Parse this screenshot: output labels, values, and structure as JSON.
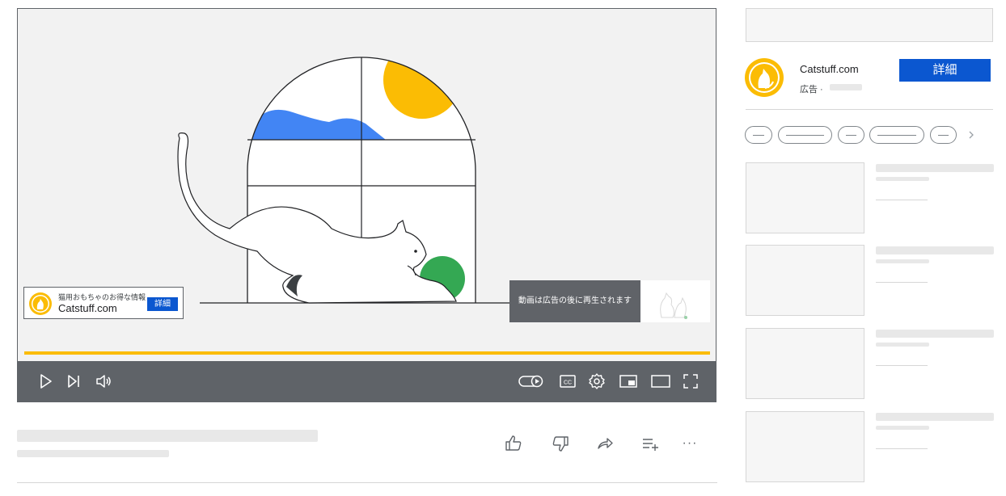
{
  "player": {
    "ad_card": {
      "tagline": "猫用おもちゃのお得な情報",
      "site": "Catstuff.com",
      "button_label": "詳細"
    },
    "after_ad_text": "動画は広告の後に再生されます",
    "progress_fraction": 1.0,
    "progress_color": "#fbbc04",
    "controls": [
      "play-icon",
      "next-icon",
      "volume-icon",
      "autoplay-toggle-icon",
      "captions-icon",
      "settings-icon",
      "miniplayer-icon",
      "theater-icon",
      "fullscreen-icon"
    ],
    "captions_label": "CC"
  },
  "actions": [
    "like-icon",
    "dislike-icon",
    "share-icon",
    "save-to-playlist-icon",
    "more-icon"
  ],
  "more_label": "···",
  "sidebar": {
    "advertiser": {
      "name": "Catstuff.com",
      "meta": "広告 ·",
      "button_label": "詳細"
    },
    "chip_next": "›"
  },
  "colors": {
    "brand_blue": "#0b57d0",
    "control_bar": "#5f6368",
    "yellow": "#fbbc04",
    "green": "#34a853",
    "sky_blue": "#4285f4"
  }
}
